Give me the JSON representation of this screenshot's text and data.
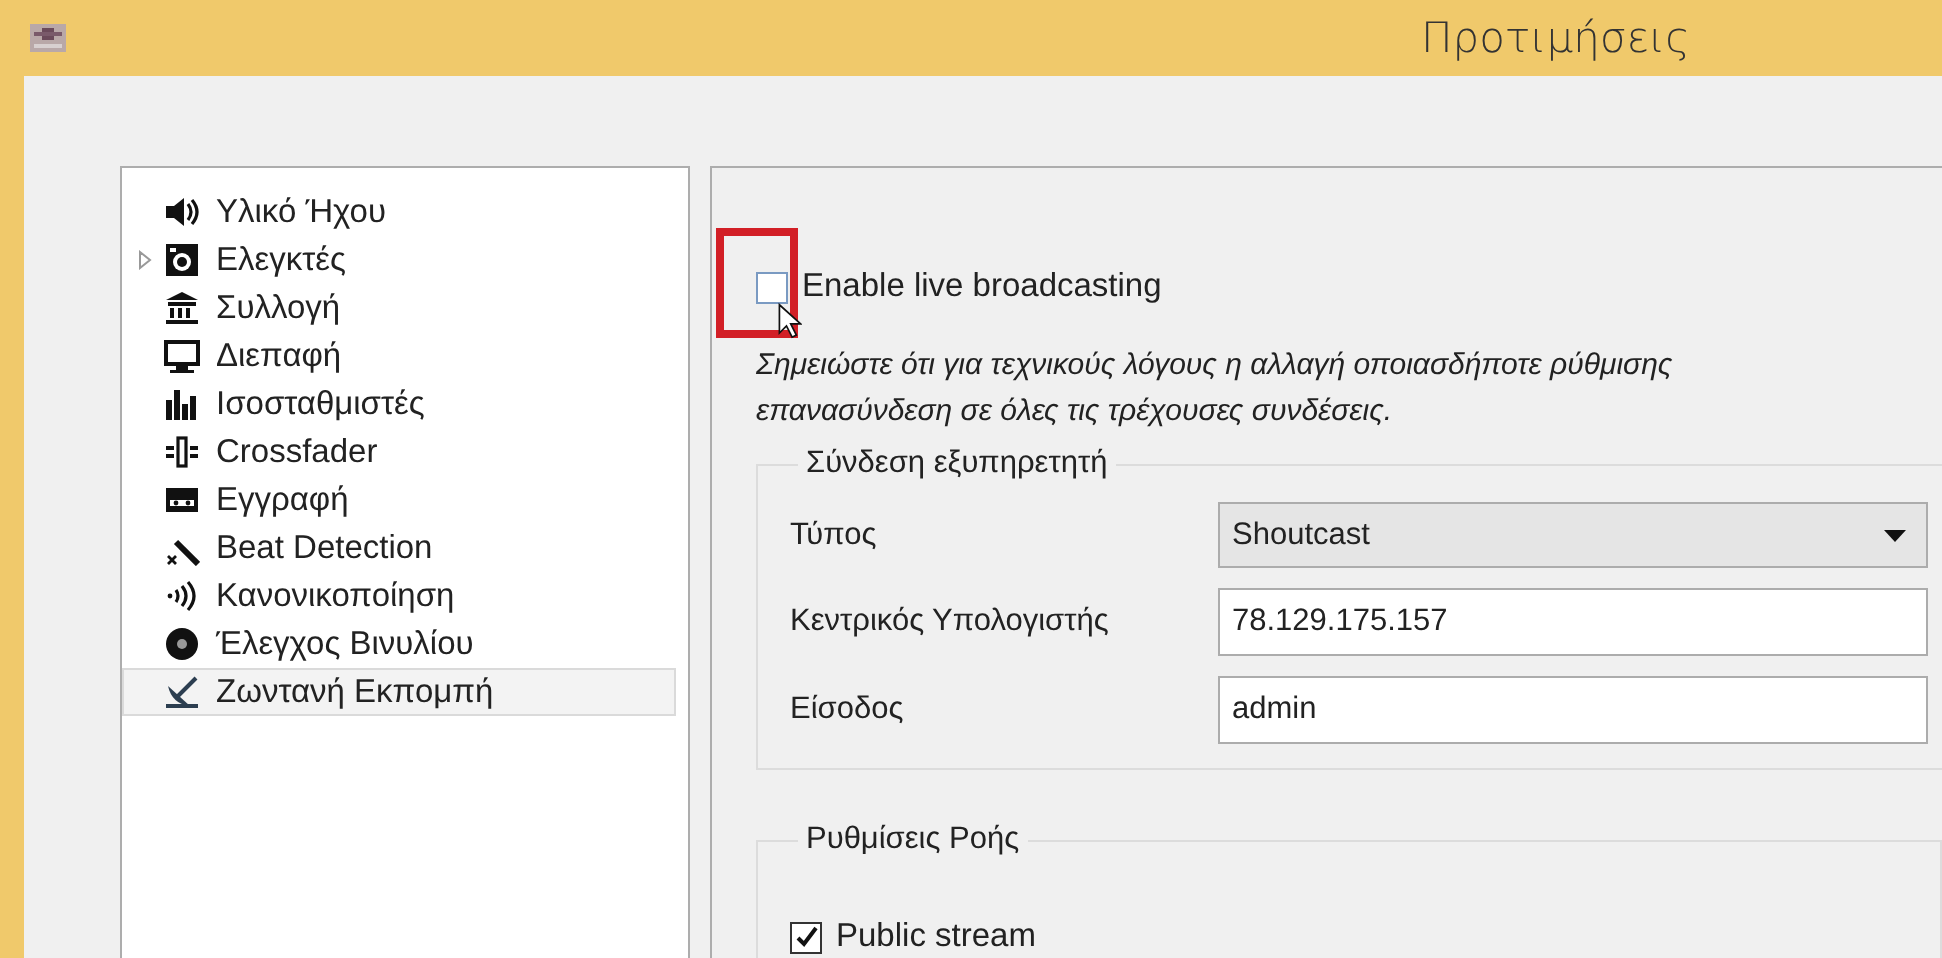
{
  "window": {
    "title": "Προτιμήσεις"
  },
  "sidebar": {
    "items": [
      {
        "kind": "speaker",
        "label": "Υλικό Ήχου",
        "expandable": false,
        "selected": false
      },
      {
        "kind": "controller",
        "label": "Ελεγκτές",
        "expandable": true,
        "selected": false
      },
      {
        "kind": "library",
        "label": "Συλλογή",
        "expandable": false,
        "selected": false
      },
      {
        "kind": "monitor",
        "label": "Διεπαφή",
        "expandable": false,
        "selected": false
      },
      {
        "kind": "equalizer",
        "label": "Ισοσταθμιστές",
        "expandable": false,
        "selected": false
      },
      {
        "kind": "crossfader",
        "label": "Crossfader",
        "expandable": false,
        "selected": false
      },
      {
        "kind": "cassette",
        "label": "Εγγραφή",
        "expandable": false,
        "selected": false
      },
      {
        "kind": "wand",
        "label": "Beat Detection",
        "expandable": false,
        "selected": false
      },
      {
        "kind": "waves",
        "label": "Κανονικοποίηση",
        "expandable": false,
        "selected": false
      },
      {
        "kind": "disc",
        "label": "Έλεγχος Βινυλίου",
        "expandable": false,
        "selected": false
      },
      {
        "kind": "dish",
        "label": "Ζωντανή Εκπομπή",
        "expandable": false,
        "selected": true
      }
    ]
  },
  "broadcast": {
    "enable": {
      "label": "Enable live broadcasting",
      "checked": false
    },
    "note": "Σημειώστε ότι για τεχνικούς λόγους η αλλαγή οποιασδήποτε ρύθμισης\nεπανασύνδεση σε όλες τις τρέχουσες συνδέσεις.",
    "server_group": {
      "title": "Σύνδεση εξυπηρετητή",
      "fields": [
        {
          "kind": "dropdown",
          "label": "Τύπος",
          "value": "Shoutcast"
        },
        {
          "kind": "text",
          "label": "Κεντρικός Υπολογιστής",
          "value": "78.129.175.157"
        },
        {
          "kind": "text",
          "label": "Είσοδος",
          "value": "admin"
        }
      ]
    },
    "stream_group": {
      "title": "Ρυθμίσεις Ροής",
      "options": [
        {
          "label": "Public stream",
          "checked": true
        }
      ]
    }
  }
}
